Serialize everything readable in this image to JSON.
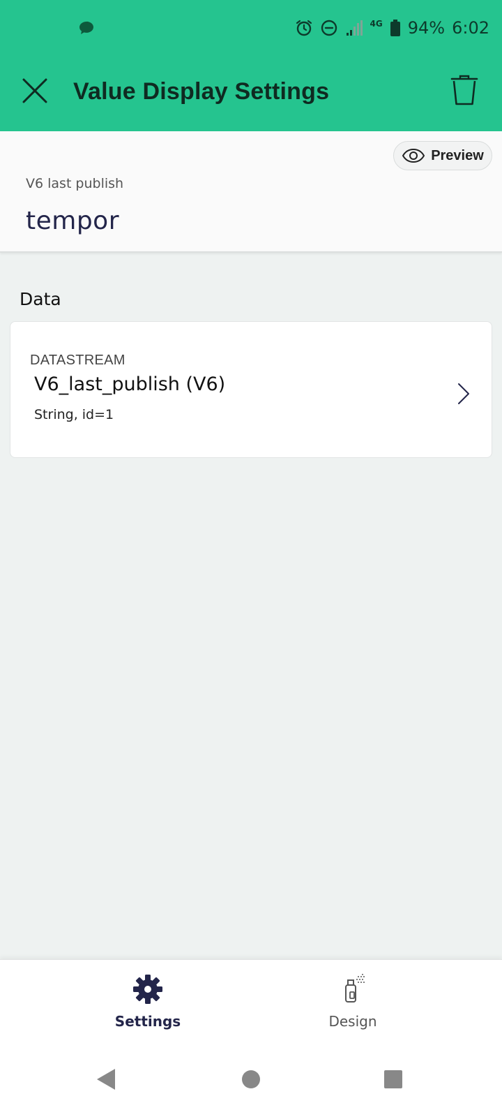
{
  "status_bar": {
    "network": "4G",
    "battery": "94%",
    "time": "6:02",
    "icons": [
      "message-icon",
      "alarm-icon",
      "do-not-disturb-icon",
      "signal-icon",
      "battery-icon"
    ]
  },
  "app_bar": {
    "title": "Value Display Settings",
    "close_icon": "close-icon",
    "delete_icon": "trash-icon"
  },
  "preview": {
    "button_label": "Preview",
    "widget_label": "V6 last publish",
    "widget_value": "tempor"
  },
  "data_section": {
    "title": "Data",
    "datastream": {
      "caption": "DATASTREAM",
      "name": "V6_last_publish (V6)",
      "meta": "String, id=1"
    }
  },
  "bottom_nav": {
    "tabs": [
      {
        "label": "Settings",
        "icon": "gear-icon",
        "active": true
      },
      {
        "label": "Design",
        "icon": "spray-paint-icon",
        "active": false
      }
    ]
  },
  "colors": {
    "primary": "#25c48f",
    "accent_navy": "#23254a",
    "background": "#eef2f1"
  }
}
